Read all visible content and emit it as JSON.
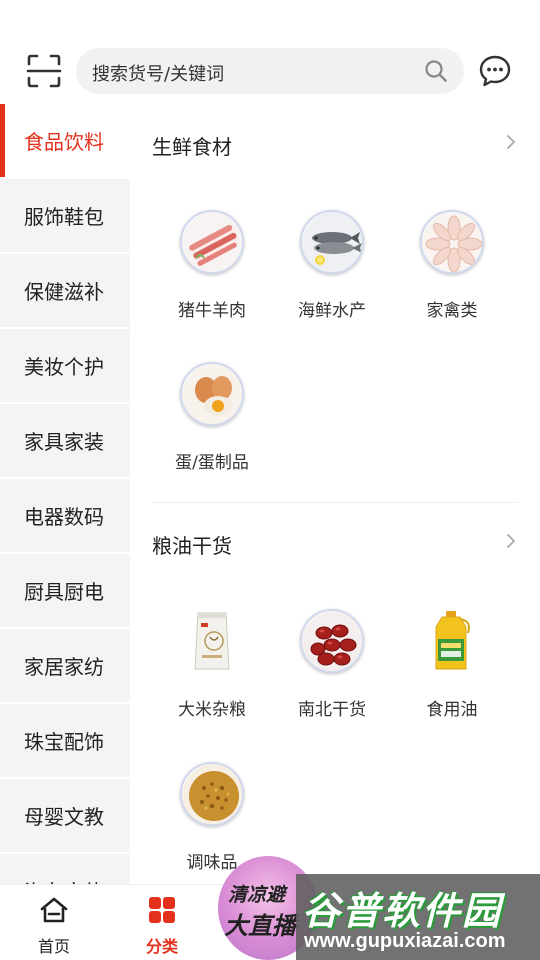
{
  "header": {
    "search_placeholder": "搜索货号/关键词"
  },
  "sidebar": {
    "items": [
      {
        "label": "食品饮料",
        "active": true
      },
      {
        "label": "服饰鞋包"
      },
      {
        "label": "保健滋补"
      },
      {
        "label": "美妆个护"
      },
      {
        "label": "家具家装"
      },
      {
        "label": "电器数码"
      },
      {
        "label": "厨具厨电"
      },
      {
        "label": "家居家纺"
      },
      {
        "label": "珠宝配饰"
      },
      {
        "label": "母婴文教"
      },
      {
        "label": "汽车文体"
      }
    ]
  },
  "sections": [
    {
      "title": "生鲜食材",
      "items": [
        {
          "label": "猪牛羊肉",
          "icon": "meat-icon"
        },
        {
          "label": "海鲜水产",
          "icon": "fish-icon"
        },
        {
          "label": "家禽类",
          "icon": "poultry-icon"
        },
        {
          "label": "蛋/蛋制品",
          "icon": "egg-icon"
        }
      ]
    },
    {
      "title": "粮油干货",
      "items": [
        {
          "label": "大米杂粮",
          "icon": "rice-bag-icon"
        },
        {
          "label": "南北干货",
          "icon": "dates-icon"
        },
        {
          "label": "食用油",
          "icon": "oil-bottle-icon"
        },
        {
          "label": "调味品",
          "icon": "seasoning-icon"
        }
      ]
    }
  ],
  "bottom_nav": {
    "home_label": "首页",
    "category_label": "分类"
  },
  "promo": {
    "line1": "清凉避",
    "line2": "大直播"
  },
  "watermark": {
    "title": "谷普软件园",
    "url": "www.gupuxiazai.com"
  },
  "colors": {
    "accent": "#e4311c",
    "sidebar_bg": "#f4f4f4"
  }
}
